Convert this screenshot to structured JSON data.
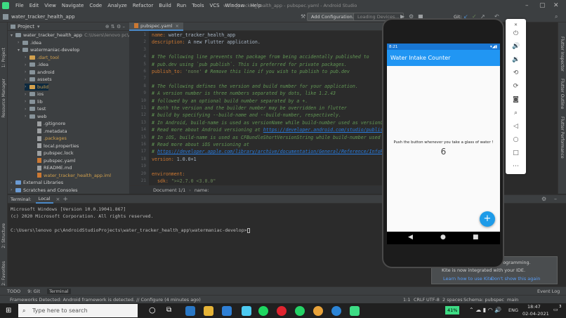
{
  "menubar": {
    "items": [
      "File",
      "Edit",
      "View",
      "Navigate",
      "Code",
      "Analyze",
      "Refactor",
      "Build",
      "Run",
      "Tools",
      "VCS",
      "Window",
      "Help"
    ],
    "title": "water_tracker_health_app - pubspec.yaml - Android Studio"
  },
  "toolbar": {
    "breadcrumb": "water_tracker_health_app",
    "add_config": "Add Configuration...",
    "devices": "Loading Devices...",
    "git_label": "Git:"
  },
  "left_strip": [
    "1: Project",
    "Resource Manager",
    "2: Structure",
    "2: Favorites",
    "Build Variants"
  ],
  "project": {
    "header": "Project",
    "tree": [
      {
        "label": "water_tracker_health_app",
        "extra": "C:\\Users\\lenovo pc\\Andro",
        "depth": 0,
        "kind": "folder",
        "open": true
      },
      {
        "label": ".idea",
        "depth": 1,
        "kind": "folder",
        "open": false
      },
      {
        "label": "watermaniac-develop",
        "depth": 1,
        "kind": "folder",
        "open": true
      },
      {
        "label": ".dart_tool",
        "depth": 2,
        "kind": "folder-orange",
        "open": false
      },
      {
        "label": ".idea",
        "depth": 2,
        "kind": "folder",
        "open": false
      },
      {
        "label": "android",
        "depth": 2,
        "kind": "folder",
        "open": false
      },
      {
        "label": "assets",
        "depth": 2,
        "kind": "folder",
        "open": false
      },
      {
        "label": "build",
        "depth": 2,
        "kind": "folder-orange",
        "open": false
      },
      {
        "label": "ios",
        "depth": 2,
        "kind": "folder",
        "open": false
      },
      {
        "label": "lib",
        "depth": 2,
        "kind": "folder",
        "open": false
      },
      {
        "label": "test",
        "depth": 2,
        "kind": "folder",
        "open": false
      },
      {
        "label": "web",
        "depth": 2,
        "kind": "folder",
        "open": false
      },
      {
        "label": ".gitignore",
        "depth": 3,
        "kind": "file"
      },
      {
        "label": ".metadata",
        "depth": 3,
        "kind": "file"
      },
      {
        "label": ".packages",
        "depth": 3,
        "kind": "file"
      },
      {
        "label": "local.properties",
        "depth": 3,
        "kind": "file"
      },
      {
        "label": "pubspec.lock",
        "depth": 3,
        "kind": "file"
      },
      {
        "label": "pubspec.yaml",
        "depth": 3,
        "kind": "file-yaml"
      },
      {
        "label": "README.md",
        "depth": 3,
        "kind": "file"
      },
      {
        "label": "water_tracker_health_app.iml",
        "depth": 3,
        "kind": "file-orange"
      },
      {
        "label": "External Libraries",
        "depth": 0,
        "kind": "lib"
      },
      {
        "label": "Scratches and Consoles",
        "depth": 0,
        "kind": "lib"
      }
    ]
  },
  "editor": {
    "tab": "pubspec.yaml",
    "lines": [
      {
        "n": "1",
        "html": "<span class='c-key'>name:</span> <span class='c-val'>water_tracker_health_app</span>"
      },
      {
        "n": "2",
        "html": "<span class='c-key'>description:</span> <span class='c-val'>A new Flutter application.</span>"
      },
      {
        "n": "3",
        "html": ""
      },
      {
        "n": "4",
        "html": "<span class='c-com'># The following line prevents the package from being accidentally published to</span>"
      },
      {
        "n": "5",
        "html": "<span class='c-com'># pub.dev using `pub publish`. This is preferred for private packages.</span>"
      },
      {
        "n": "6",
        "html": "<span class='c-key'>publish_to:</span> <span class='c-str'>'none'</span> <span class='c-com'># Remove this line if you wish to publish to pub.dev</span>"
      },
      {
        "n": "7",
        "html": ""
      },
      {
        "n": "8",
        "html": "<span class='c-com'># The following defines the version and build number for your application.</span>"
      },
      {
        "n": "9",
        "html": "<span class='c-com'># A version number is three numbers separated by dots, like 1.2.43</span>"
      },
      {
        "n": "10",
        "html": "<span class='c-com'># followed by an optional build number separated by a +.</span>"
      },
      {
        "n": "11",
        "html": "<span class='c-com'># Both the version and the builder number may be overridden in flutter</span>"
      },
      {
        "n": "12",
        "html": "<span class='c-com'># build by specifying --build-name and --build-number, respectively.</span>"
      },
      {
        "n": "13",
        "html": "<span class='c-com'># In Android, build-name is used as versionName while build-number used as versionCode.</span>"
      },
      {
        "n": "14",
        "html": "<span class='c-com'># Read more about Android versioning at </span><span class='c-link'>https://developer.android.com/studio/publish/ve</span>"
      },
      {
        "n": "15",
        "html": "<span class='c-com'># In iOS, build-name is used as CFBundleShortVersionString while build-number used as C</span>"
      },
      {
        "n": "16",
        "html": "<span class='c-com'># Read more about iOS versioning at</span>"
      },
      {
        "n": "17",
        "html": "<span class='c-com'># </span><span class='c-link'>https://developer.apple.com/library/archive/documentation/General/Reference/InfoPlist</span>"
      },
      {
        "n": "18",
        "html": "<span class='c-key'>version:</span> <span class='c-val'>1.0.0+1</span>"
      },
      {
        "n": "19",
        "html": ""
      },
      {
        "n": "20",
        "html": "<span class='c-key'>environment:</span>"
      },
      {
        "n": "21",
        "html": "  <span class='c-key'>sdk:</span> <span class='c-str'>\">=2.7.0 &lt;3.0.0\"</span>"
      }
    ],
    "breadcrumb_doc": "Document 1/1",
    "breadcrumb_key": "name:"
  },
  "terminal": {
    "title": "Terminal:",
    "tab": "Local",
    "lines": [
      "Microsoft Windows [Version 10.0.19041.867]",
      "(c) 2020 Microsoft Corporation. All rights reserved.",
      "",
      "C:\\Users\\lenovo pc\\AndroidStudioProjects\\water_tracker_health_app\\watermaniac-develop>"
    ]
  },
  "bottom_tools": [
    "TODO",
    "9: Git",
    "Terminal"
  ],
  "right_strip": [
    "Flutter Inspector",
    "Flutter Outline",
    "Flutter Performance"
  ],
  "status": {
    "message": "Frameworks Detected: Android framework is detected. // Configure (4 minutes ago)",
    "position": "1:1",
    "line_sep": "CRLF",
    "encoding": "UTF-8",
    "indent": "2 spaces",
    "schema": "Schema: pubspec",
    "branch": "main",
    "event_log": "Event Log"
  },
  "notification": {
    "line1": "...ogramming.",
    "line2": "Kite is now integrated with your IDE.",
    "link1": "Learn how to use Kite",
    "link2": "Don't show this again"
  },
  "phone": {
    "status_time": "8:21",
    "app_title": "Water Intake Counter",
    "prompt": "Push the button whenever you take a glass of water !",
    "count": "6",
    "fab": "+"
  },
  "taskbar": {
    "search_placeholder": "Type here to search",
    "battery": "41%",
    "lang": "ENG",
    "time": "18:47",
    "date": "02-04-2021",
    "notif_count": "3"
  },
  "colors": {
    "app_bar": "#2196f3",
    "status_bar": "#1976d2",
    "fab": "#1e9be8",
    "ide_bg": "#2b2b2b",
    "panel": "#3c3f41"
  }
}
